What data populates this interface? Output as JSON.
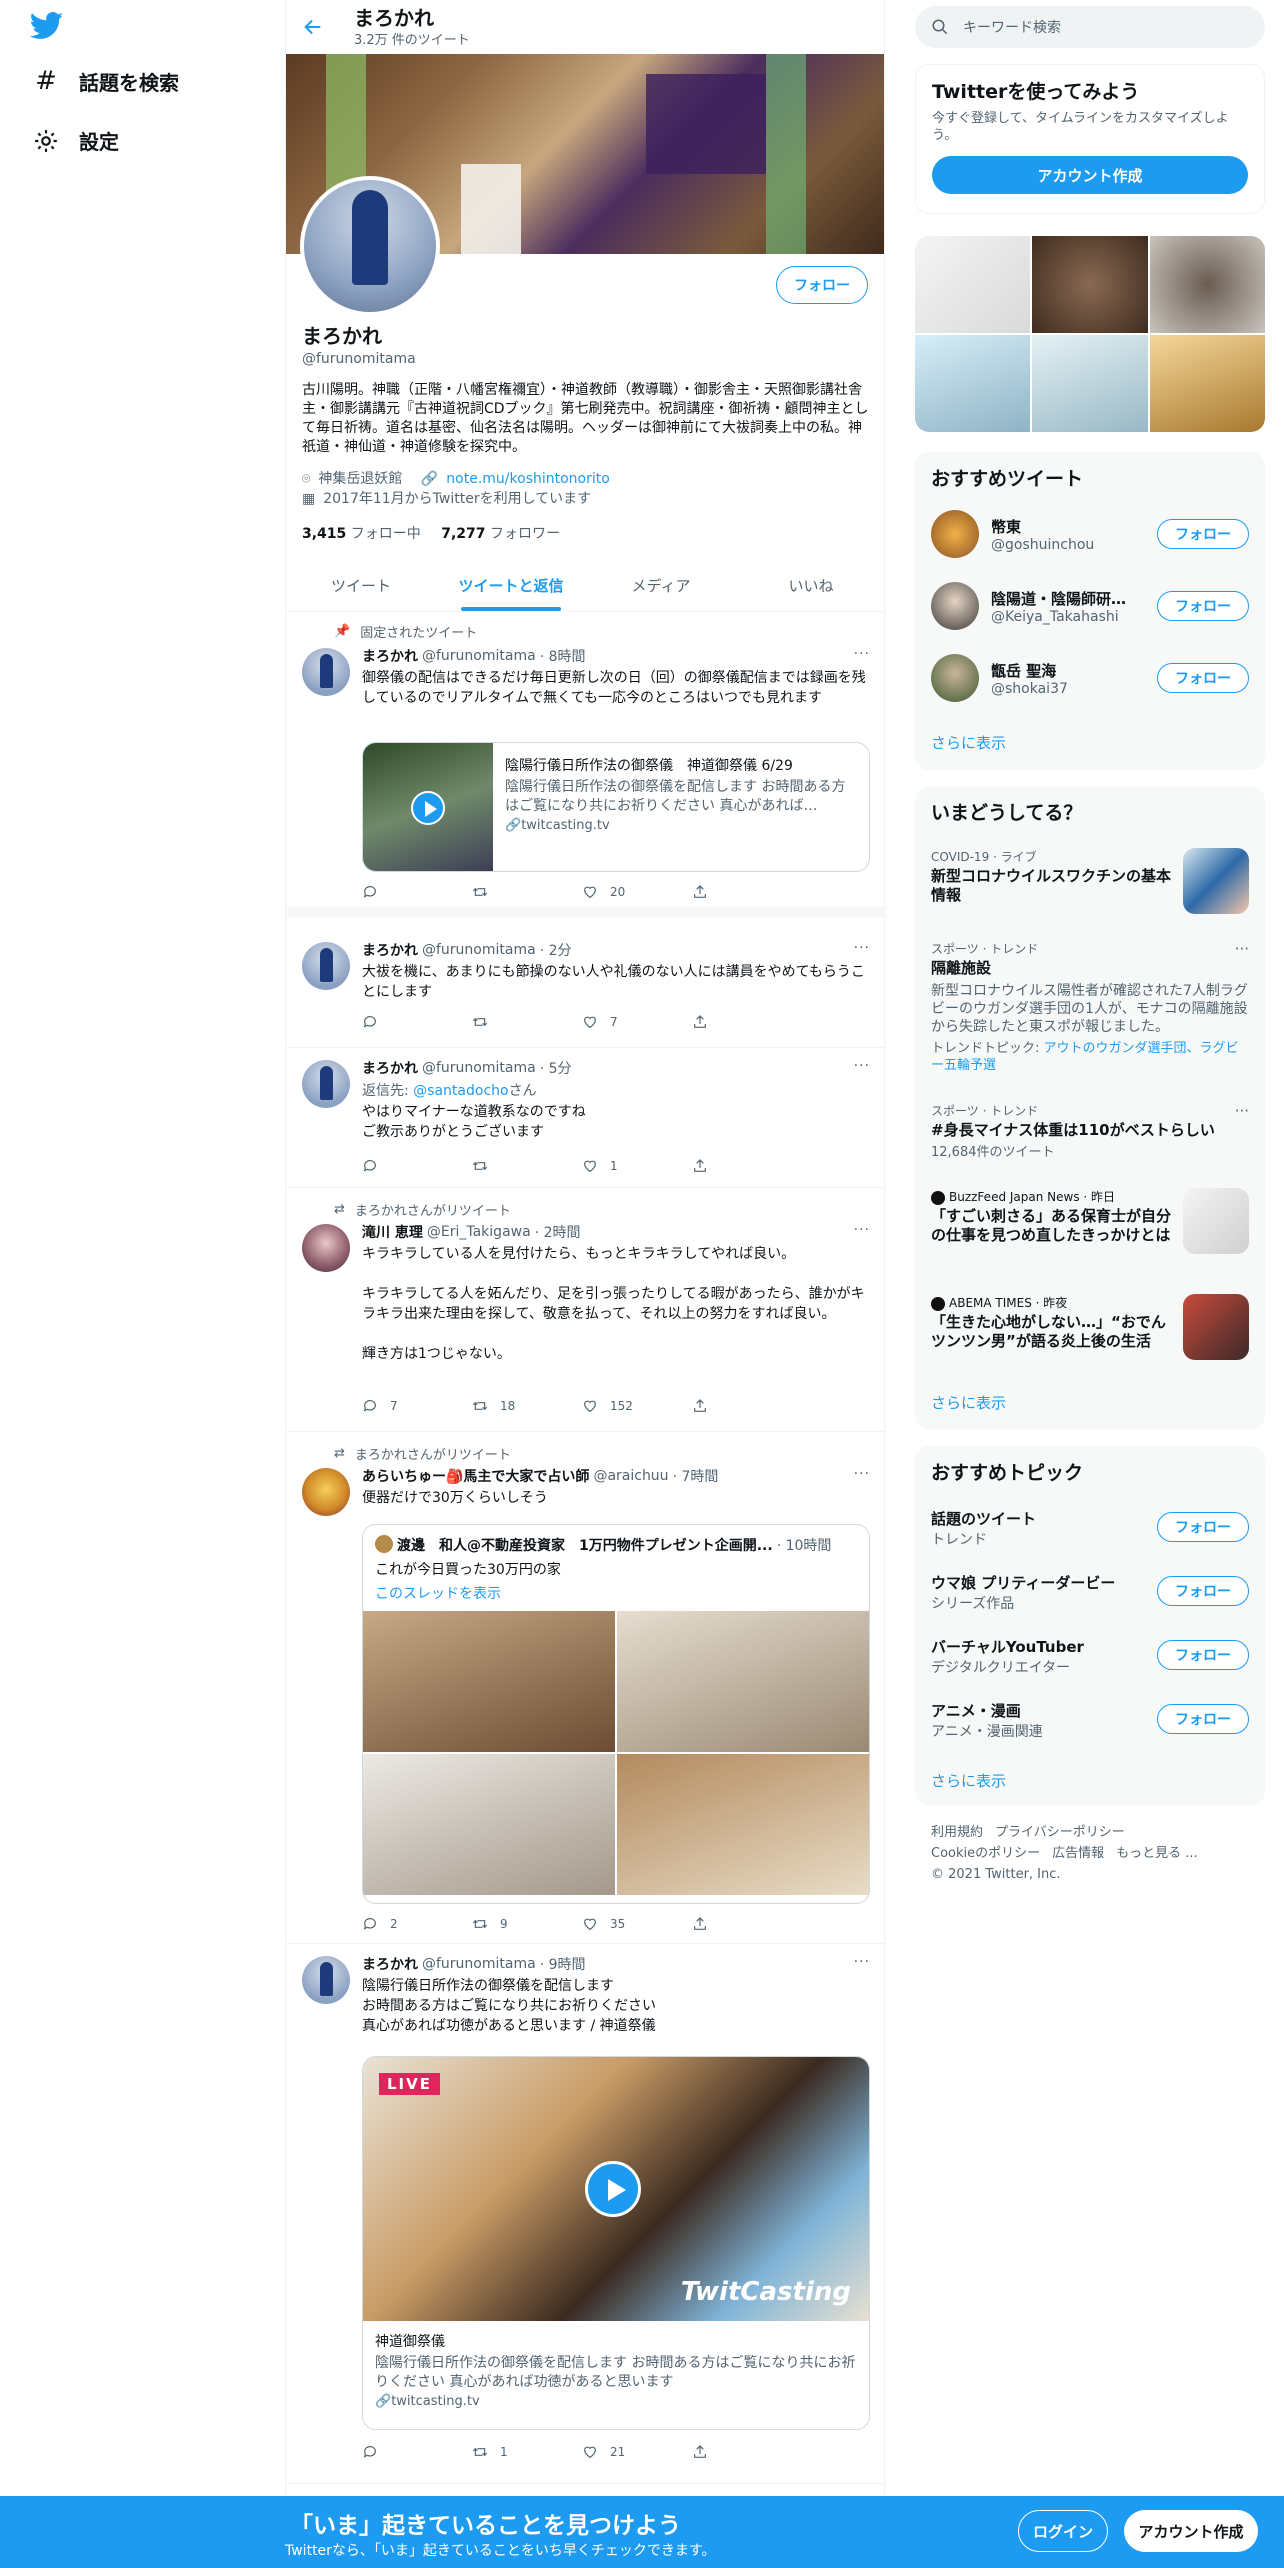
{
  "nav": {
    "explore_label": "話題を検索",
    "settings_label": "設定"
  },
  "header": {
    "name": "まろかれ",
    "tweet_count": "3.2万 件のツイート"
  },
  "profile": {
    "name": "まろかれ",
    "handle": "@furunomitama",
    "follow_label": "フォロー",
    "bio": "古川陽明。神職（正階・八幡宮権禰宜）・神道教師（教導職）・御影舎主・天照御影講社舎主・御影講講元『古神道祝詞CDブック』第七刷発売中。祝詞講座・御祈祷・顧問神主として毎日祈祷。道名は基密、仙名法名は陽明。ヘッダーは御神前にて大祓詞奏上中の私。神祇道・神仙道・神道修験を探究中。",
    "location": "神集岳退妖館",
    "link": "note.mu/koshintonorito",
    "joined": "2017年11月からTwitterを利用しています",
    "following_count": "3,415",
    "following_label": "フォロー中",
    "followers_count": "7,277",
    "followers_label": "フォロワー"
  },
  "tabs": [
    "ツイート",
    "ツイートと返信",
    "メディア",
    "いいね"
  ],
  "tweets": [
    {
      "context": "固定されたツイート",
      "name": "まろかれ",
      "handle": "@furunomitama",
      "time": "· 8時間",
      "text": "御祭儀の配信はできるだけ毎日更新し次の日（回）の御祭儀配信までは録画を残しているのでリアルタイムで無くても一応今のところはいつでも見れます",
      "card_title": "陰陽行儀日所作法の御祭儀　神道御祭儀 6/29",
      "card_desc": "陰陽行儀日所作法の御祭儀を配信します お時間ある方はご覧になり共にお祈りください 真心があれば…",
      "card_domain": "twitcasting.tv",
      "reply": "",
      "retweet": "",
      "like": "20"
    },
    {
      "name": "まろかれ",
      "handle": "@furunomitama",
      "time": "· 2分",
      "text": "大祓を機に、あまりにも節操のない人や礼儀のない人には講員をやめてもらうことにします",
      "reply": "",
      "retweet": "",
      "like": "7"
    },
    {
      "name": "まろかれ",
      "handle": "@furunomitama",
      "time": "· 5分",
      "reply_to_prefix": "返信先: ",
      "reply_to_handle": "@santadocho",
      "reply_to_suffix": "さん",
      "text": "やはりマイナーな道教系なのですね\nご教示ありがとうございます",
      "reply": "",
      "retweet": "",
      "like": "1"
    },
    {
      "context": "まろかれさんがリツイート",
      "name": "滝川 恵理",
      "handle": "@Eri_Takigawa",
      "time": "· 2時間",
      "text": "キラキラしている人を見付けたら、もっとキラキラしてやれば良い。\n\nキラキラしてる人を妬んだり、足を引っ張ったりしてる暇があったら、誰かがキラキラ出来た理由を探して、敬意を払って、それ以上の努力をすれば良い。\n\n輝き方は1つじゃない。",
      "reply": "7",
      "retweet": "18",
      "like": "152"
    },
    {
      "context": "まろかれさんがリツイート",
      "name": "あらいちゅー🎒馬主で大家で占い師",
      "handle": "@araichuu",
      "time": "· 7時間",
      "text": "便器だけで30万くらいしそう",
      "quote_name": "渡邊　和人@不動産投資家　1万円物件プレゼント企画開...",
      "quote_time": "· 10時間",
      "quote_text": "これが今日買った30万円の家",
      "quote_thread": "このスレッドを表示",
      "reply": "2",
      "retweet": "9",
      "like": "35"
    },
    {
      "name": "まろかれ",
      "handle": "@furunomitama",
      "time": "· 9時間",
      "text": "陰陽行儀日所作法の御祭儀を配信します\nお時間ある方はご覧になり共にお祈りください\n真心があれば功徳があると思います / 神道祭儀",
      "live_badge": "LIVE",
      "watermark": "TwitCasting",
      "card_title": "神道御祭儀",
      "card_desc": "陰陽行儀日所作法の御祭儀を配信します お時間ある方はご覧になり共にお祈りください 真心があれば功徳があると思います",
      "card_domain": "twitcasting.tv",
      "reply": "",
      "retweet": "1",
      "like": "21"
    }
  ],
  "right": {
    "search_placeholder": "キーワード検索",
    "signup_title": "Twitterを使ってみよう",
    "signup_sub": "今すぐ登録して、タイムラインをカスタマイズしよう。",
    "signup_button": "アカウント作成",
    "who_to_follow_title": "おすすめツイート",
    "follow_label": "フォロー",
    "users": [
      {
        "name": "幣東",
        "handle": "@goshuinchou"
      },
      {
        "name": "陰陽道・陰陽師研究...",
        "handle": "@Keiya_Takahashi"
      },
      {
        "name": "甑岳 聖海",
        "handle": "@shokai37"
      }
    ],
    "show_more": "さらに表示",
    "trends_title": "いまどうしてる？",
    "trends": [
      {
        "cat": "COVID-19 · ライブ",
        "title": "新型コロナウイルスワクチンの基本情報"
      },
      {
        "cat": "スポーツ · トレンド",
        "title": "隔離施設",
        "text": "新型コロナウイルス陽性者が確認された7人制ラグビーのウガンダ選手団の1人が、モナコの隔離施設から失踪したと東スポが報じました。",
        "related_prefix": "トレンドトピック: ",
        "related": "アウトのウガンダ選手団、ラグビー五輪予選"
      },
      {
        "cat": "スポーツ · トレンド",
        "title": "#身長マイナス体重は110がベストらしい",
        "count": "12,684件のツイート"
      },
      {
        "cat": "BuzzFeed Japan News · 昨日",
        "title": "「すごい刺さる」ある保育士が自分の仕事を見つめ直したきっかけとは"
      },
      {
        "cat": "ABEMA TIMES · 昨夜",
        "title": "「生きた心地がしない…」“おでんツンツン男”が語る炎上後の生活"
      }
    ],
    "topics_title": "おすすめトピック",
    "topics": [
      {
        "title": "話題のツイート",
        "cat": "トレンド"
      },
      {
        "title": "ウマ娘 プリティーダービー",
        "cat": "シリーズ作品"
      },
      {
        "title": "バーチャルYouTuber",
        "cat": "デジタルクリエイター"
      },
      {
        "title": "アニメ・漫画",
        "cat": "アニメ・漫画関連"
      }
    ],
    "footer_line1": [
      "利用規約",
      "プライバシーポリシー"
    ],
    "footer_line2": [
      "Cookieのポリシー",
      "広告情報",
      "もっと見る ..."
    ],
    "copyright": "© 2021 Twitter, Inc."
  },
  "bottombar": {
    "title": "「いま」起きていることを見つけよう",
    "sub": "Twitterなら、「いま」起きていることをいち早くチェックできます。",
    "login": "ログイン",
    "signup": "アカウント作成"
  },
  "colors": {
    "accent": "#1d9bf0",
    "text": "#0f1419",
    "muted": "#536471"
  }
}
